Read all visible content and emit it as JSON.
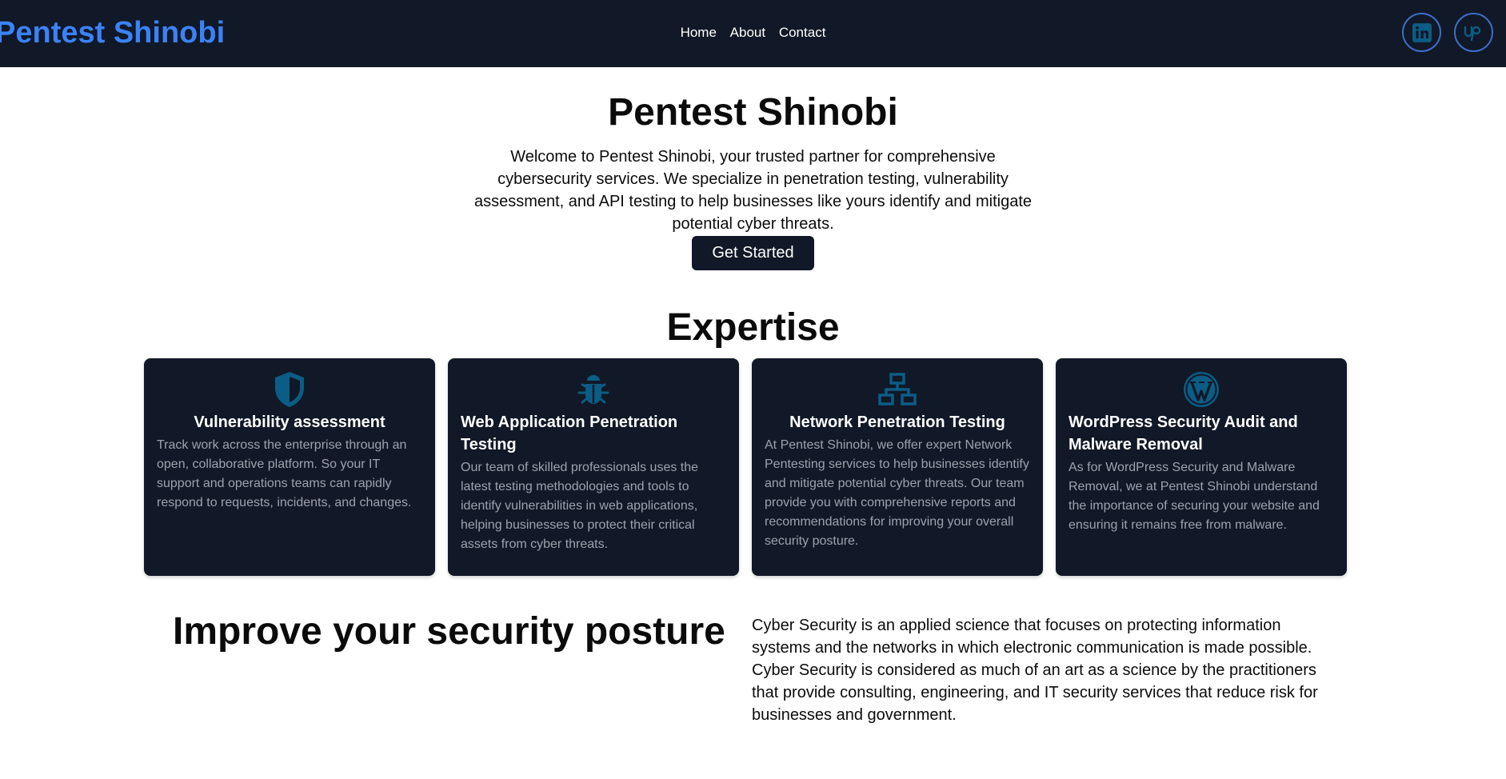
{
  "nav": {
    "brand": "Pentest Shinobi",
    "links": [
      "Home",
      "About",
      "Contact"
    ],
    "socials": [
      {
        "icon": "linkedin-icon",
        "label": "LinkedIn"
      },
      {
        "icon": "upwork-icon",
        "label": "Upwork"
      }
    ]
  },
  "hero": {
    "title": "Pentest Shinobi",
    "text": "Welcome to Pentest Shinobi, your trusted partner for comprehensive cybersecurity services. We specialize in penetration testing, vulnerability assessment, and API testing to help businesses like yours identify and mitigate potential cyber threats.",
    "cta": "Get Started"
  },
  "expertise": {
    "title": "Expertise",
    "cards": [
      {
        "icon": "shield-icon",
        "title": "Vulnerability assessment",
        "text": "Track work across the enterprise through an open, collaborative platform. So your IT support and operations teams can rapidly respond to requests, incidents, and changes."
      },
      {
        "icon": "bug-icon",
        "title": "Web Application Penetration Testing",
        "text": "Our team of skilled professionals uses the latest testing methodologies and tools to identify vulnerabilities in web applications, helping businesses to protect their critical assets from cyber threats."
      },
      {
        "icon": "network-icon",
        "title": "Network Penetration Testing",
        "text": "At Pentest Shinobi, we offer expert Network Pentesting services to help businesses identify and mitigate potential cyber threats. Our team provide you with comprehensive reports and recommendations for improving your overall security posture."
      },
      {
        "icon": "wordpress-icon",
        "title": "WordPress Security Audit and Malware Removal",
        "text": "As for WordPress Security and Malware Removal, we at Pentest Shinobi understand the importance of securing your website and ensuring it remains free from malware."
      }
    ]
  },
  "posture": {
    "title": "Improve your security posture",
    "text": "Cyber Security is an applied science that focuses on protecting information systems and the networks in which electronic communication is made possible. Cyber Security is considered as much of an art as a science by the practitioners that provide consulting, engineering, and IT security services that reduce risk for businesses and government."
  },
  "colors": {
    "nav_bg": "#111827",
    "brand": "#3b82f6",
    "icon": "#0b5d85",
    "card_text": "#9ca3af"
  }
}
